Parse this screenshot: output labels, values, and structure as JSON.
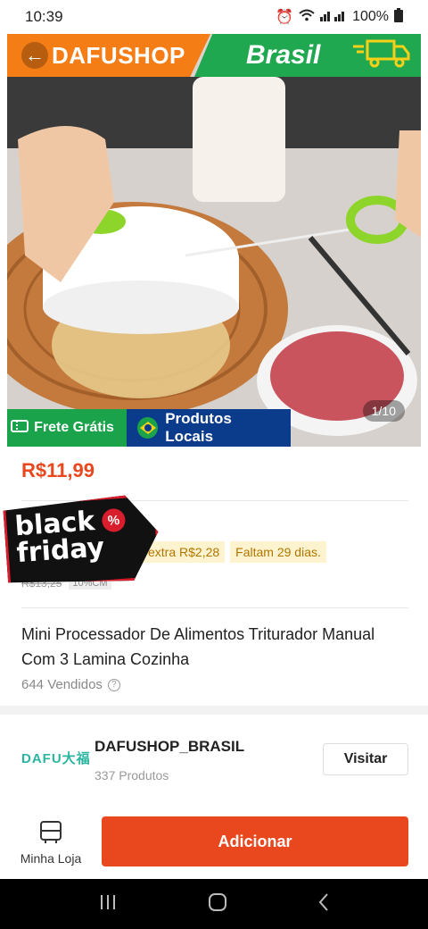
{
  "status": {
    "time": "10:39",
    "battery": "100%"
  },
  "banner": {
    "shop": "DAFUSHOP",
    "country": "Brasil"
  },
  "image": {
    "counter": "1/10"
  },
  "badges": {
    "frete": "Frete Grátis",
    "locais": "Produtos Locais"
  },
  "price": "R$11,99",
  "promo": {
    "extra": "extra R$2,28",
    "countdown": "Faltam 29 dias."
  },
  "old_price": {
    "value": "R$13,25",
    "tag": "10%CM"
  },
  "sticker": {
    "line1": "black",
    "line2": "friday",
    "pct": "%"
  },
  "product": {
    "title": "Mini Processador De Alimentos Triturador Manual Com 3 Lamina Cozinha",
    "sold": "644 Vendidos"
  },
  "store": {
    "logo": "DAFU大福",
    "name": "DAFUSHOP_BRASIL",
    "count": "337 Produtos",
    "visit": "Visitar"
  },
  "bottom": {
    "mystore": "Minha Loja",
    "add": "Adicionar"
  },
  "colors": {
    "accent": "#e9471e",
    "green": "#1aa34a",
    "orange": "#f57d16",
    "navy": "#0b3c8c"
  }
}
